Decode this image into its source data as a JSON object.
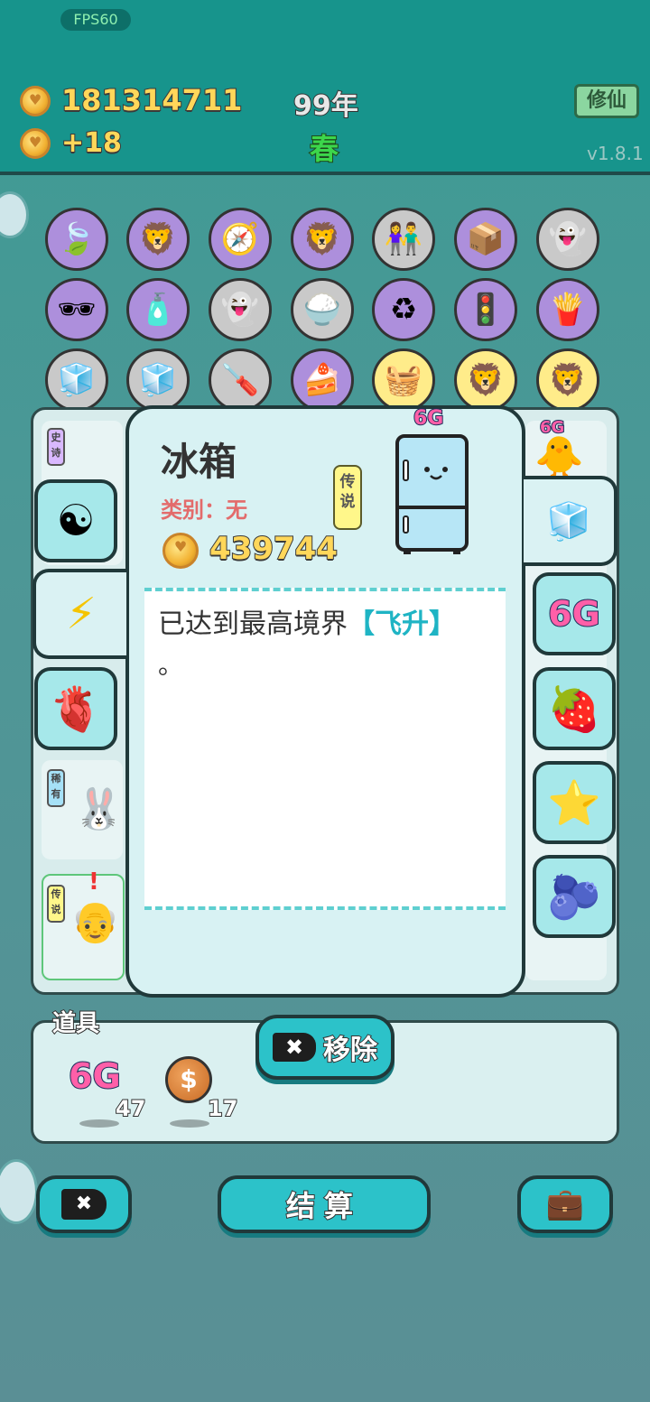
{
  "header": {
    "fps": "FPS60",
    "coins": "181314711",
    "income": "+18",
    "year": "99年",
    "season": "春",
    "xiuxian_button": "修仙",
    "version": "v1.8.1"
  },
  "dialog": {
    "title": "冰箱",
    "category": "类别：无",
    "rarity": "传说",
    "badge": "6G",
    "price": "439744",
    "description_prefix": "已达到最高境界",
    "description_highlight": "【飞升】",
    "description_suffix": "。"
  },
  "side_tabs": {
    "left": [
      "yin-yang-icon",
      "lightning-icon",
      "liver-icon"
    ],
    "right_labels": [
      "6G"
    ],
    "right": [
      "fridge-icon",
      "6g-icon",
      "lychee-icon",
      "star-icon",
      "blueberry-icon"
    ]
  },
  "background_cards": {
    "tags": [
      "史诗",
      "稀有",
      "传说"
    ],
    "badge": "6G"
  },
  "props": {
    "title": "道具",
    "items": [
      {
        "name": "6G",
        "count": "47"
      },
      {
        "name": "coin",
        "count": "17"
      }
    ],
    "remove_label": "移除"
  },
  "bottom": {
    "settle_label": "结算"
  },
  "colors": {
    "teal": "#17948c",
    "button": "#2cc2c9",
    "highlight": "#1fb4c4",
    "category": "#e36b6b",
    "gold": "#ffd75a"
  }
}
